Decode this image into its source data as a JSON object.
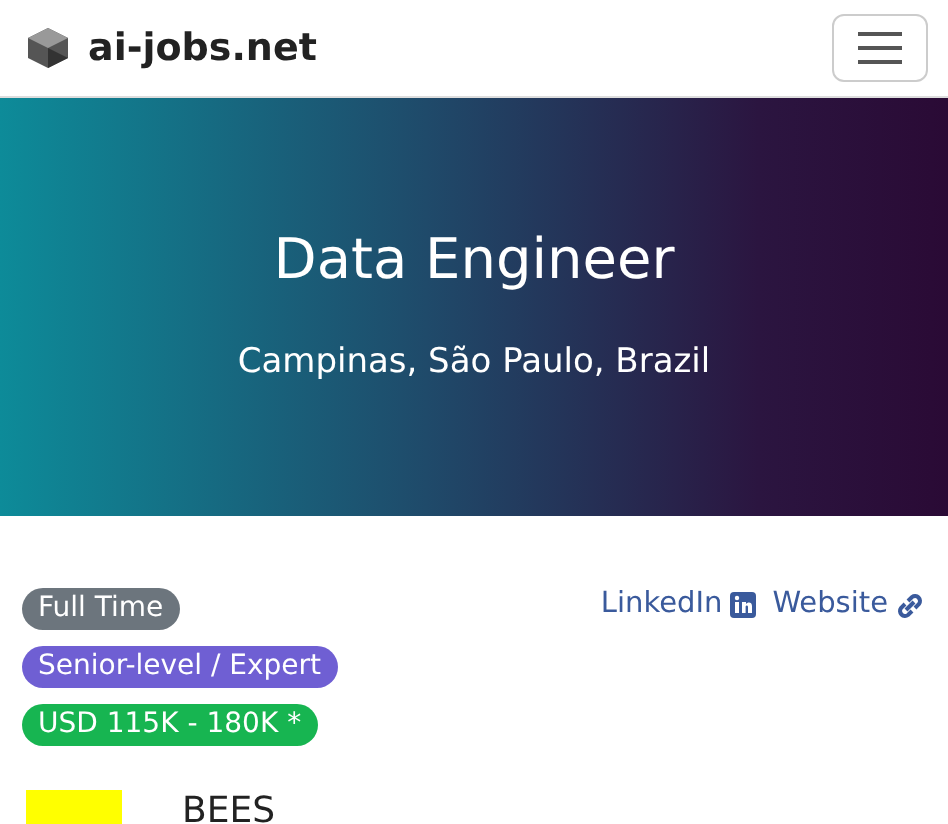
{
  "navbar": {
    "brand": "ai-jobs.net",
    "menu_expanded": false
  },
  "hero": {
    "title": "Data Engineer",
    "location": "Campinas, São Paulo, Brazil"
  },
  "tags": [
    {
      "label": "Full Time",
      "color": "#6c757d"
    },
    {
      "label": "Senior-level / Expert",
      "color": "#6f5fd3"
    },
    {
      "label": "USD 115K - 180K *",
      "color": "#17b551"
    }
  ],
  "links": [
    {
      "label": "LinkedIn",
      "kind": "linkedin"
    },
    {
      "label": "Website",
      "kind": "website"
    }
  ],
  "company": {
    "name": "BEES"
  }
}
